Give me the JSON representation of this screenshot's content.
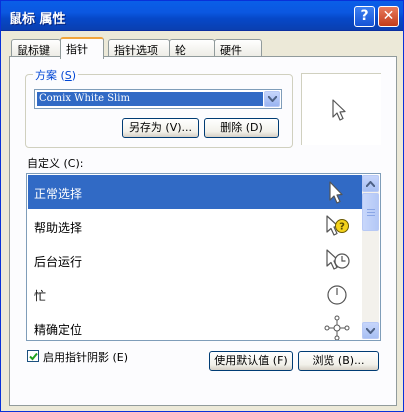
{
  "window": {
    "title": "鼠标 属性",
    "help_label": "?",
    "close_label": "✕"
  },
  "tabs": [
    {
      "label": "鼠标键"
    },
    {
      "label": "指针",
      "active": true
    },
    {
      "label": "指针选项"
    },
    {
      "label": "轮"
    },
    {
      "label": "硬件"
    }
  ],
  "scheme": {
    "label_prefix": "方案 (",
    "label_key": "S",
    "label_suffix": ")",
    "selected": "Comix White Slim",
    "save_as_label": "另存为 (V)...",
    "delete_label": "删除 (D)"
  },
  "customize": {
    "label": "自定义 (C):",
    "items": [
      {
        "label": "正常选择",
        "icon": "arrow-cursor-icon",
        "selected": true
      },
      {
        "label": "帮助选择",
        "icon": "help-cursor-icon"
      },
      {
        "label": "后台运行",
        "icon": "working-in-background-cursor-icon"
      },
      {
        "label": "忙",
        "icon": "busy-cursor-icon"
      },
      {
        "label": "精确定位",
        "icon": "precision-cursor-icon"
      }
    ]
  },
  "shadow": {
    "label": "启用指针阴影 (E)",
    "checked": true
  },
  "buttons": {
    "use_default_label": "使用默认值 (F)",
    "browse_label": "浏览 (B)..."
  },
  "colors": {
    "title_bar": "#0b57e0",
    "selection": "#316ac5",
    "panel": "#fcfcfe",
    "frame": "#ece9d8",
    "help_badge": "#f4d21c"
  }
}
